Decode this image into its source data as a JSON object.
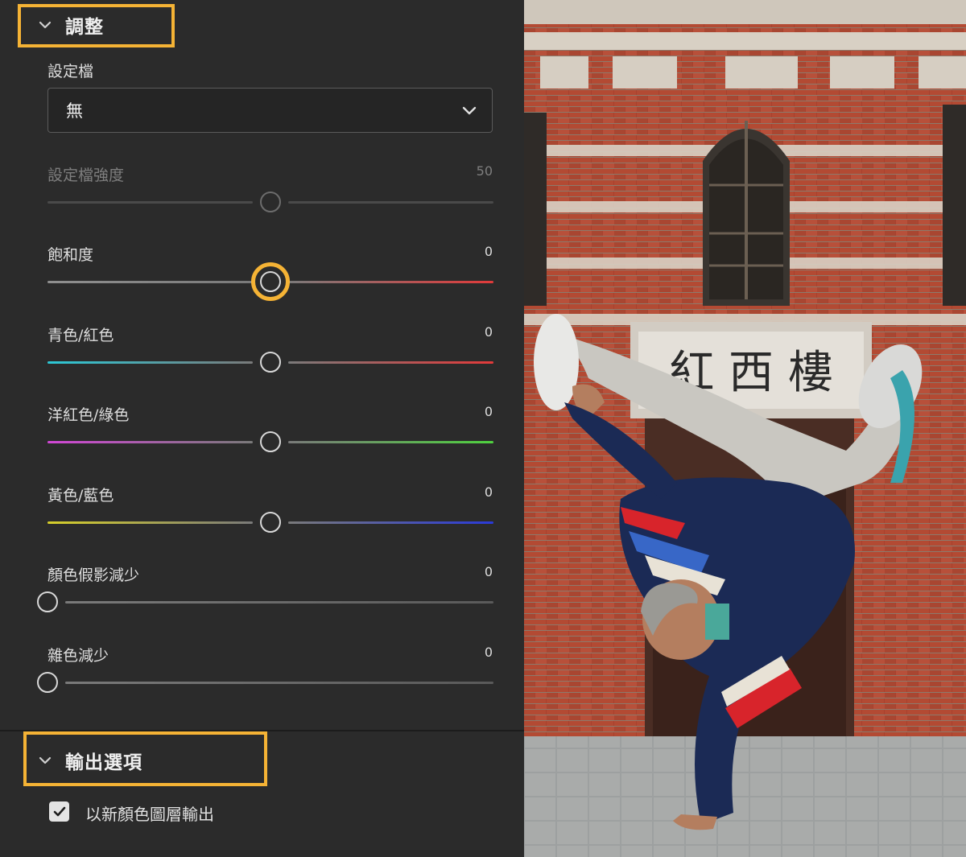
{
  "adjust_section": {
    "title": "調整",
    "profile_label": "設定檔",
    "profile_value": "無",
    "profile_strength": {
      "label": "設定檔強度",
      "value": "50",
      "level": 50,
      "enabled": false
    },
    "sliders": [
      {
        "id": "saturation",
        "label": "飽和度",
        "value": "0",
        "level": 50,
        "colors": [
          "#8f8f8f",
          "#e03a3a"
        ],
        "focused": true
      },
      {
        "id": "cyan-red",
        "label": "青色/紅色",
        "value": "0",
        "level": 50,
        "colors": [
          "#2cc8d6",
          "#e33a3a"
        ]
      },
      {
        "id": "magenta-green",
        "label": "洋紅色/綠色",
        "value": "0",
        "level": 50,
        "colors": [
          "#d247d6",
          "#4fd23f"
        ]
      },
      {
        "id": "yellow-blue",
        "label": "黃色/藍色",
        "value": "0",
        "level": 50,
        "colors": [
          "#d6cf2a",
          "#2a3ad8"
        ]
      },
      {
        "id": "color-artifact-reduction",
        "label": "顏色假影減少",
        "value": "0",
        "level": 0,
        "colors": [
          "#5a5a5a",
          "#5a5a5a"
        ]
      },
      {
        "id": "noise-reduction",
        "label": "雜色減少",
        "value": "0",
        "level": 0,
        "colors": [
          "#5a5a5a",
          "#5a5a5a"
        ]
      }
    ]
  },
  "output_section": {
    "title": "輸出選項",
    "checkbox_label": "以新顏色圖層輸出",
    "checkbox_checked": true
  },
  "photo": {
    "sign_text": "紅 西 樓",
    "accent": "#f5b335"
  }
}
